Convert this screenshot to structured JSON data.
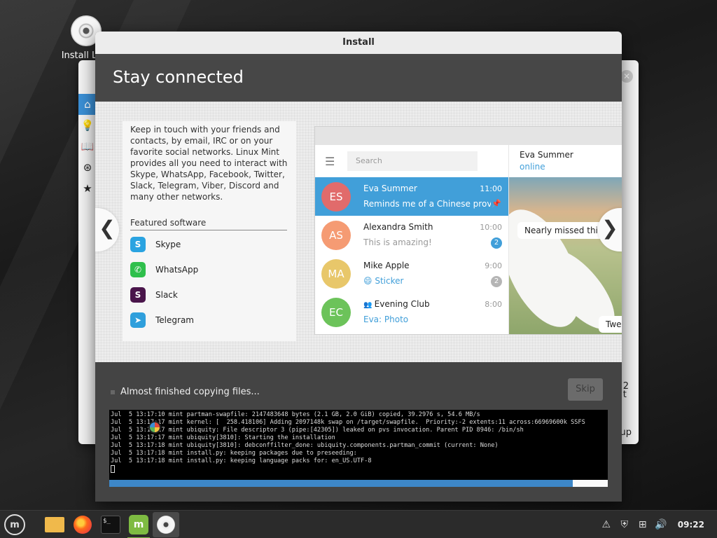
{
  "desktop": {
    "icon_label": "Install Linu"
  },
  "background_window": {
    "sidebar_icons": [
      "home-icon",
      "bulb-icon",
      "book-icon",
      "lifebuoy-icon",
      "star-icon"
    ],
    "partial_text_a": "2\nt",
    "partial_text_b": "up"
  },
  "window": {
    "title": "Install",
    "heading": "Stay connected"
  },
  "slide": {
    "description": "Keep in touch with your friends and contacts, by email, IRC or on your favorite social networks. Linux Mint provides all you need to interact with Skype, WhatsApp, Facebook, Twitter, Slack, Telegram, Viber, Discord and many other networks.",
    "featured_title": "Featured software",
    "apps": [
      {
        "name": "Skype",
        "icon": "skype-icon",
        "color": "#2aa3e1",
        "glyph": "S"
      },
      {
        "name": "WhatsApp",
        "icon": "whatsapp-icon",
        "color": "#2fbf4c",
        "glyph": "✆"
      },
      {
        "name": "Slack",
        "icon": "slack-icon",
        "color": "#4a154b",
        "glyph": "S"
      },
      {
        "name": "Telegram",
        "icon": "telegram-icon",
        "color": "#2f9fdc",
        "glyph": "➤"
      }
    ],
    "prev_glyph": "❮",
    "next_glyph": "❯"
  },
  "telegram": {
    "search_placeholder": "Search",
    "chats": [
      {
        "initials": "ES",
        "name": "Eva Summer",
        "time": "11:00",
        "message": "Reminds me of a Chinese prover...",
        "avatar_color": "#e16b6b",
        "active": true,
        "badge": "",
        "pinned": true
      },
      {
        "initials": "AS",
        "name": "Alexandra Smith",
        "time": "10:00",
        "message": "This is amazing!",
        "avatar_color": "#f59b73",
        "active": false,
        "badge": "2",
        "badge_color": "#419fd9"
      },
      {
        "initials": "MA",
        "name": "Mike Apple",
        "time": "9:00",
        "message": "😄 Sticker",
        "avatar_color": "#e8c76a",
        "active": false,
        "badge": "2",
        "badge_color": "#b5b5b5",
        "link": true
      },
      {
        "initials": "EC",
        "name": "Evening Club",
        "time": "8:00",
        "message": "Eva: Photo",
        "avatar_color": "#6cc35a",
        "active": false,
        "badge": "",
        "link": true,
        "group": true
      }
    ],
    "conversation": {
      "name": "Eva Summer",
      "status": "online",
      "bubble1": "Nearly missed this s",
      "bubble2": "Twe"
    }
  },
  "progress": {
    "status": "Almost finished copying files...",
    "skip_label": "Skip",
    "fraction": 0.93,
    "log": [
      "Jul  5 13:17:10 mint partman-swapfile: 2147483648 bytes (2.1 GB, 2.0 GiB) copied, 39.2976 s, 54.6 MB/s",
      "Jul  5 13:17:17 mint kernel: [  258.418106] Adding 2097148k swap on /target/swapfile.  Priority:-2 extents:11 across:66969600k SSFS",
      "Jul  5 13:17:17 mint ubiquity: File descriptor 3 (pipe:[42305]) leaked on pvs invocation. Parent PID 8946: /bin/sh",
      "Jul  5 13:17:17 mint ubiquity[3810]: Starting the installation",
      "Jul  5 13:17:18 mint ubiquity[3810]: debconffilter_done: ubiquity.components.partman_commit (current: None)",
      "Jul  5 13:17:18 mint install.py: keeping packages due to preseeding:",
      "Jul  5 13:17:18 mint install.py: keeping language packs for: en_US.UTF-8"
    ]
  },
  "taskbar": {
    "clock": "09:22",
    "menu_glyph": "m",
    "terminal_glyph": "$_",
    "mint_glyph": "m"
  }
}
